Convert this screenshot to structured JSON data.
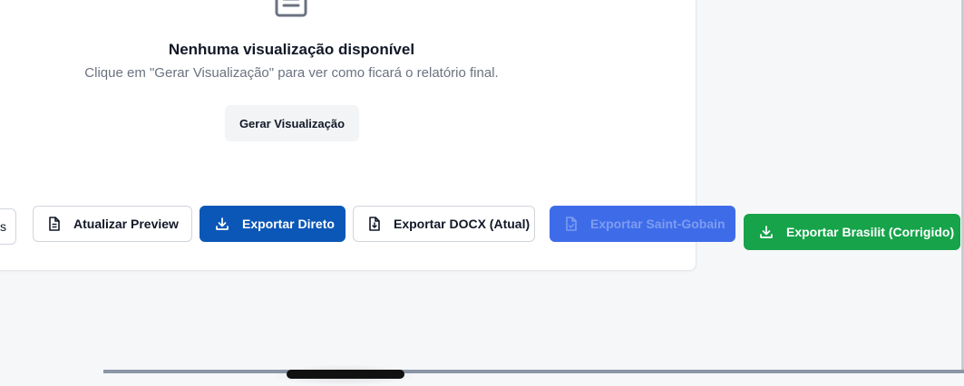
{
  "empty_state": {
    "icon": "document-icon",
    "title": "Nenhuma visualização disponível",
    "subtitle": "Clique em \"Gerar Visualização\" para ver como ficará o relatório final.",
    "generate_button": "Gerar Visualização"
  },
  "actions": {
    "partial_label": "s",
    "update_preview": {
      "label": "Atualizar Preview",
      "icon": "file-text-icon"
    },
    "export_direct": {
      "label": "Exportar Direto",
      "icon": "download-icon",
      "color": "#0b57b7"
    },
    "export_docx": {
      "label": "Exportar DOCX (Atual)",
      "icon": "file-download-icon"
    },
    "export_saint_gobain": {
      "label": "Exportar Saint-Gobain",
      "icon": "file-check-icon",
      "color": "#3e6ce9",
      "disabled": true
    },
    "export_brasilit": {
      "label": "Exportar Brasilit (Corrigido)",
      "icon": "download-icon",
      "color": "#16a34a"
    }
  }
}
